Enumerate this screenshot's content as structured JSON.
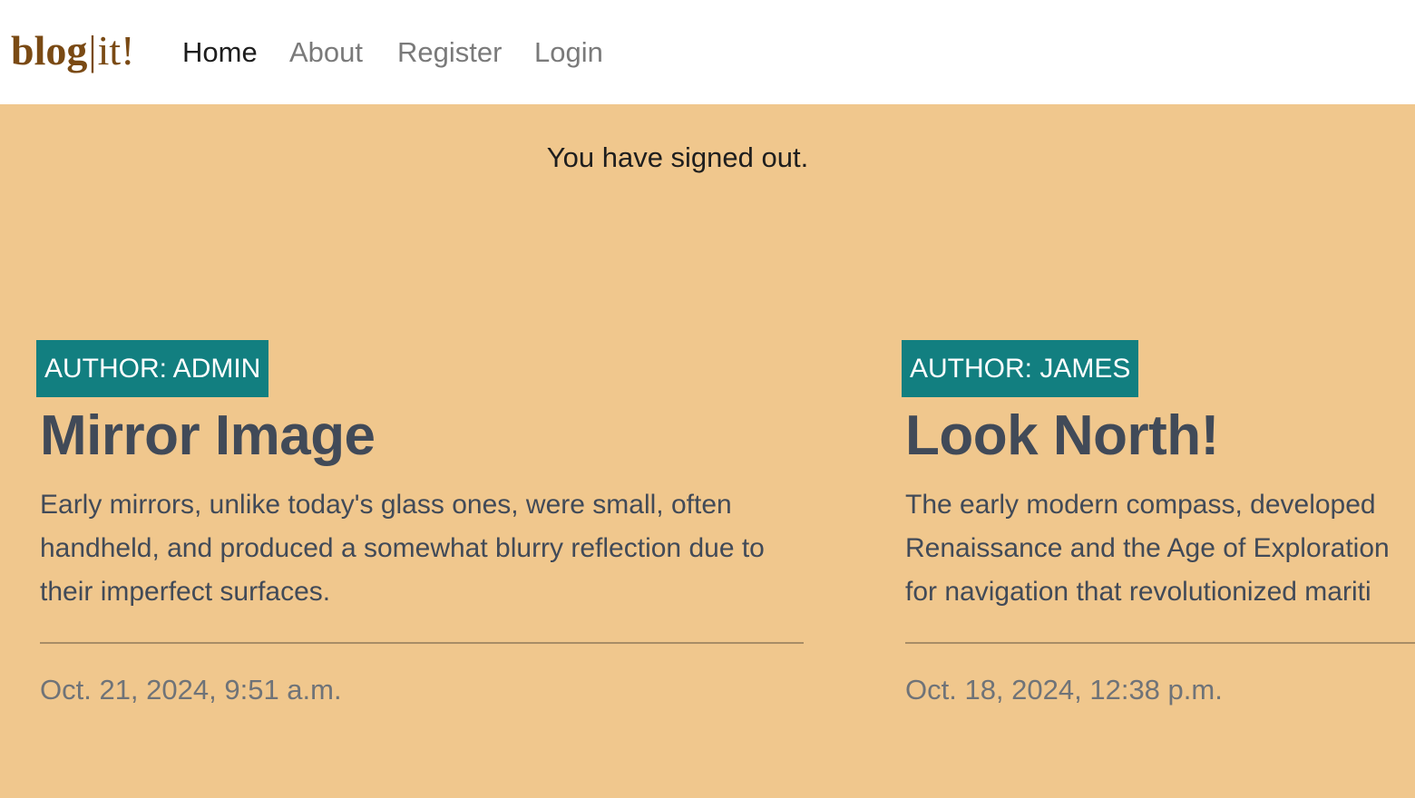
{
  "brand": {
    "bold": "blog",
    "separator": "|",
    "light": "it!"
  },
  "nav": {
    "items": [
      {
        "label": "Home",
        "active": true
      },
      {
        "label": "About",
        "active": false
      },
      {
        "label": "Register",
        "active": false
      },
      {
        "label": "Login",
        "active": false
      }
    ]
  },
  "flash": {
    "message": "You have signed out."
  },
  "posts": [
    {
      "author": "AUTHOR: ADMIN",
      "title": "Mirror Image",
      "excerpt": "Early mirrors, unlike today's glass ones, were small, often handheld, and produced a somewhat blurry reflection due to their imperfect surfaces.",
      "date": "Oct. 21, 2024, 9:51 a.m."
    },
    {
      "author": "AUTHOR: JAMES",
      "title": "Look North!",
      "excerpt_lines": [
        "The early modern compass, developed",
        "Renaissance and the Age of Exploration",
        "for navigation that revolutionized mariti"
      ],
      "date": "Oct. 18, 2024, 12:38 p.m."
    }
  ],
  "colors": {
    "page_background": "#f0c78d",
    "navbar_background": "#ffffff",
    "brand": "#7a4a14",
    "author_badge": "#127f80",
    "heading_text": "#414a58",
    "date_text": "#6f7378"
  }
}
